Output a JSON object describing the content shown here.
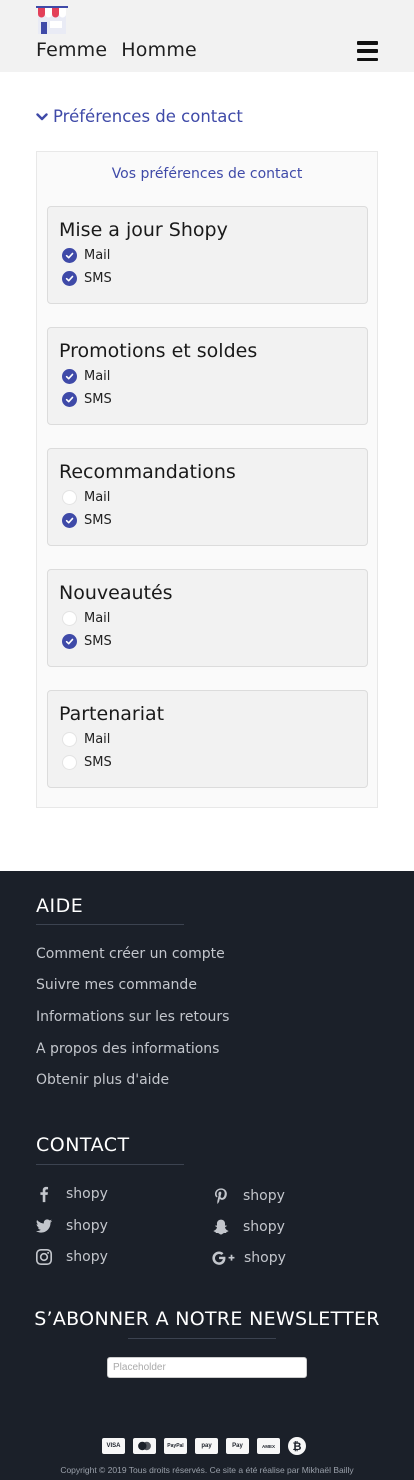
{
  "header": {
    "nav": [
      "Femme",
      "Homme"
    ]
  },
  "section_toggle": "Préférences de contact",
  "prefs": {
    "title": "Vos préférences de contact",
    "cards": [
      {
        "title": "Mise a jour Shopy",
        "options": [
          {
            "label": "Mail",
            "checked": true
          },
          {
            "label": "SMS",
            "checked": true
          }
        ]
      },
      {
        "title": "Promotions et soldes",
        "options": [
          {
            "label": "Mail",
            "checked": true
          },
          {
            "label": "SMS",
            "checked": true
          }
        ]
      },
      {
        "title": "Recommandations",
        "options": [
          {
            "label": "Mail",
            "checked": false
          },
          {
            "label": "SMS",
            "checked": true
          }
        ]
      },
      {
        "title": "Nouveautés",
        "options": [
          {
            "label": "Mail",
            "checked": false
          },
          {
            "label": "SMS",
            "checked": true
          }
        ]
      },
      {
        "title": "Partenariat",
        "options": [
          {
            "label": "Mail",
            "checked": false
          },
          {
            "label": "SMS",
            "checked": false
          }
        ]
      }
    ]
  },
  "footer": {
    "aide_title": "AIDE",
    "aide_links": [
      "Comment créer un compte",
      "Suivre mes commande",
      "Informations sur les retours",
      "A propos des informations",
      "Obtenir plus d'aide"
    ],
    "contact_title": "CONTACT",
    "social": [
      {
        "icon": "facebook-icon",
        "label": "shopy"
      },
      {
        "icon": "pinterest-icon",
        "label": "shopy"
      },
      {
        "icon": "twitter-icon",
        "label": "shopy"
      },
      {
        "icon": "snapchat-icon",
        "label": "shopy"
      },
      {
        "icon": "instagram-icon",
        "label": "shopy"
      },
      {
        "icon": "google-plus-icon",
        "label": "shopy"
      }
    ],
    "newsletter_title": "S’ABONNER A NOTRE NEWSLETTER",
    "newsletter_placeholder": "Placeholder",
    "payments": [
      "VISA",
      "mastercard",
      "PayPal",
      "pay",
      "Pay",
      "AMEX",
      "₿"
    ],
    "copyright": "Copyright © 2019 Tous droits réservés. Ce site a été réalise par Mikhaël Bailly"
  },
  "colors": {
    "accent": "#3f4aa8",
    "footer_bg": "#1b2029",
    "header_bg": "#f2f2f2"
  }
}
